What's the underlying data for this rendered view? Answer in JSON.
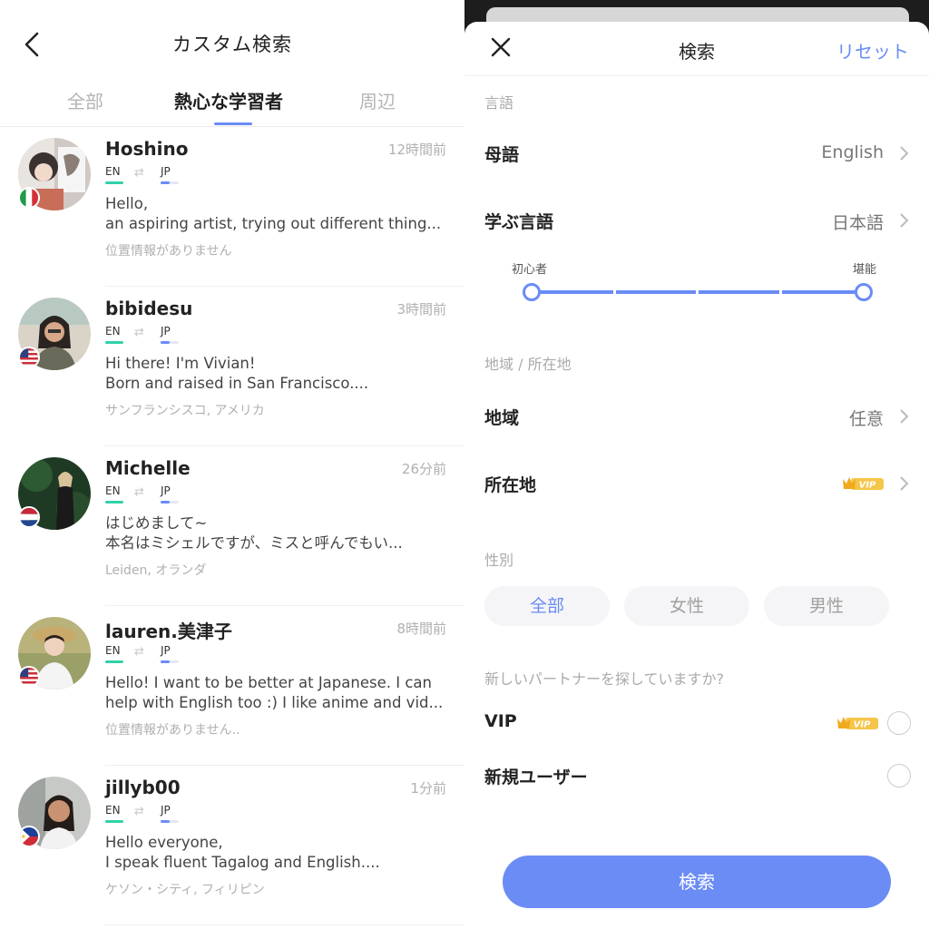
{
  "left": {
    "title": "カスタム検索",
    "tabs": [
      "全部",
      "熱心な学習者",
      "周辺"
    ],
    "users": [
      {
        "name": "Hoshino",
        "time": "12時間前",
        "native": "EN",
        "learning": "JP",
        "bio1": "Hello,",
        "bio2": "an aspiring artist, trying out different thing...",
        "location": "位置情報がありません",
        "flag": "italy"
      },
      {
        "name": "bibidesu",
        "time": "3時間前",
        "native": "EN",
        "learning": "JP",
        "bio1": "Hi there! I'm Vivian!",
        "bio2": "Born and raised in San Francisco....",
        "location": "サンフランシスコ, アメリカ",
        "flag": "usa"
      },
      {
        "name": "Michelle",
        "time": "26分前",
        "native": "EN",
        "learning": "JP",
        "bio1": "はじめまして~",
        "bio2": "本名はミシェルですが、ミスと呼んでもい...",
        "location": "Leiden, オランダ",
        "flag": "netherlands"
      },
      {
        "name": "lauren.美津子",
        "time": "8時間前",
        "native": "EN",
        "learning": "JP",
        "bio1": "Hello! I want to be better at Japanese. I can",
        "bio2": "help with English too :) I like anime and vid...",
        "location": "位置情報がありません..",
        "flag": "usa"
      },
      {
        "name": "jillyb00",
        "time": "1分前",
        "native": "EN",
        "learning": "JP",
        "bio1": "Hello everyone,",
        "bio2": "I speak fluent Tagalog and English....",
        "location": "ケソン・シティ, フィリピン",
        "flag": "philippines"
      }
    ]
  },
  "right": {
    "title": "検索",
    "reset": "リセット",
    "section_language": "言語",
    "native_label": "母語",
    "native_value": "English",
    "learn_label": "学ぶ言語",
    "learn_value": "日本語",
    "level_low": "初心者",
    "level_high": "堪能",
    "level_range": [
      0,
      1
    ],
    "section_region": "地域 / 所在地",
    "region_label": "地域",
    "region_value": "任意",
    "location_label": "所在地",
    "section_gender": "性別",
    "gender_options": [
      "全部",
      "女性",
      "男性"
    ],
    "gender_selected": "全部",
    "section_partner": "新しいパートナーを探していますか?",
    "vip_label": "VIP",
    "vip_badge": "VIP",
    "new_user_label": "新規ユーザー",
    "search_button": "検索"
  },
  "colors": {
    "accent": "#6a8cf5",
    "native_bar": "#30d2a8"
  }
}
